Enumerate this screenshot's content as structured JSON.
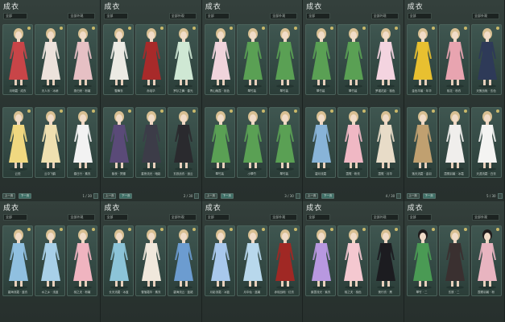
{
  "panels": [
    {
      "title": "成衣",
      "filter": "全部",
      "sort": "全部外观",
      "cards": [
        {
          "name": "月明霜 · 成衣",
          "c": "#c84548",
          "h": "#d8bf92"
        },
        {
          "name": "天人乐 · 冰绡",
          "c": "#ece2dc",
          "h": "#d8bf92"
        },
        {
          "name": "燕归来 · 粉裳",
          "c": "#e6c0c4",
          "h": "#d8bf92"
        },
        {
          "name": "云鬓",
          "c": "#f0d880",
          "h": "#d8bf92"
        },
        {
          "name": "云中飞鹤",
          "c": "#efe0b0",
          "h": "#d8bf92"
        },
        {
          "name": "春日行 · 素衣",
          "c": "#f2f2f2",
          "h": "#d8bf92"
        }
      ],
      "pager": {
        "prev": "上一页",
        "next": "下一页",
        "info": "1 / 30"
      }
    },
    {
      "title": "成衣",
      "filter": "全部",
      "sort": "全部外观",
      "cards": [
        {
          "name": "雪舞衣",
          "c": "#ecebe4",
          "h": "#d8bf92"
        },
        {
          "name": "赤焰华",
          "c": "#a82a2a",
          "h": "#d8bf92"
        },
        {
          "name": "罗衫之舞 · 春光",
          "c": "#cfe8d4",
          "h": "#d8bf92"
        },
        {
          "name": "紫夜 · 冥蝶",
          "c": "#5a4a78",
          "h": "#d8bf92"
        },
        {
          "name": "星夜流光 · 暗影",
          "c": "#3c3c48",
          "h": "#d8bf92"
        },
        {
          "name": "玄铁战衣 · 追云",
          "c": "#2a2a2e",
          "h": "#d8bf92"
        }
      ],
      "pager": {
        "prev": "上一页",
        "next": "下一页",
        "info": "2 / 30"
      }
    },
    {
      "title": "成衣",
      "filter": "全部",
      "sort": "全部外观",
      "cards": [
        {
          "name": "青山晚霞 · 桃色",
          "c": "#f0d4dc",
          "h": "#d8bf92"
        },
        {
          "name": "翠竹装",
          "c": "#5aa054",
          "h": "#d8bf92"
        },
        {
          "name": "翠竹装",
          "c": "#5aa054",
          "h": "#d8bf92"
        },
        {
          "name": "翠竹装",
          "c": "#5aa054",
          "h": "#d8bf92"
        },
        {
          "name": "小翠竹",
          "c": "#5aa054",
          "h": "#d8bf92"
        },
        {
          "name": "翠竹装",
          "c": "#5aa054",
          "h": "#d8bf92"
        }
      ],
      "pager": {
        "prev": "上一页",
        "next": "下一页",
        "info": "3 / 30"
      }
    },
    {
      "title": "成衣",
      "filter": "全部",
      "sort": "全部外观",
      "cards": [
        {
          "name": "翠竹装",
          "c": "#5aa054",
          "h": "#d8bf92"
        },
        {
          "name": "翠竹装",
          "c": "#5aa054",
          "h": "#d8bf92"
        },
        {
          "name": "罗裙花影 · 桃色",
          "c": "#f4d4e0",
          "h": "#d8bf92"
        },
        {
          "name": "碧月流霜",
          "c": "#88b4d8",
          "h": "#d8bf92"
        },
        {
          "name": "霞霓 · 粉衣",
          "c": "#f0b8c4",
          "h": "#d8bf92"
        },
        {
          "name": "霞霓 · 月华",
          "c": "#e8dcc8",
          "h": "#d8bf92"
        }
      ],
      "pager": {
        "prev": "上一页",
        "next": "下一页",
        "info": "4 / 30"
      }
    },
    {
      "title": "成衣",
      "filter": "全部",
      "sort": "全部外观",
      "cards": [
        {
          "name": "金色华裳 · 年华",
          "c": "#e8c030",
          "h": "#d8bf92"
        },
        {
          "name": "桃花 · 粉衣",
          "c": "#e8a4b0",
          "h": "#d8bf92"
        },
        {
          "name": "天策战袍 · 玄色",
          "c": "#2e3a58",
          "h": "#d8bf92"
        },
        {
          "name": "落天流霜 · 金羽",
          "c": "#c0a070",
          "h": "#d8bf92"
        },
        {
          "name": "霞霓羽裳 · 冰霜",
          "c": "#f0eeec",
          "h": "#d8bf92"
        },
        {
          "name": "天涯流霜 · 白衣",
          "c": "#f4f4f2",
          "h": "#d8bf92"
        }
      ],
      "pager": {
        "prev": "上一页",
        "next": "下一页",
        "info": "5 / 30"
      }
    },
    {
      "title": "成衣",
      "filter": "全部",
      "sort": "全部外观",
      "cards": [
        {
          "name": "碧海流霜 · 蓝衣",
          "c": "#90c0e0",
          "h": "#d8bf92"
        },
        {
          "name": "水之乡 · 浅蓝",
          "c": "#a8d0e8",
          "h": "#d8bf92"
        },
        {
          "name": "桃之夭 · 粉裳",
          "c": "#f0b4c0",
          "h": "#d8bf92"
        }
      ]
    },
    {
      "title": "成衣",
      "filter": "全部",
      "sort": "全部外观",
      "cards": [
        {
          "name": "长天流霜 · 冰蓝",
          "c": "#8cc4d8",
          "h": "#d8bf92"
        },
        {
          "name": "雪落霜华 · 素衣",
          "c": "#f0e8dc",
          "h": "#d8bf92"
        },
        {
          "name": "碧海流云 · 蓝裙",
          "c": "#6c9cd0",
          "h": "#d8bf92"
        }
      ]
    },
    {
      "title": "成衣",
      "filter": "全部",
      "sort": "全部外观",
      "cards": [
        {
          "name": "月影流霜 · 冰蓝",
          "c": "#a8c8ec",
          "h": "#d8bf92"
        },
        {
          "name": "月中仙 · 蓝裳",
          "c": "#b8d8ec",
          "h": "#d8bf92"
        },
        {
          "name": "赤焰战袍 · 红衣",
          "c": "#a02824",
          "h": "#d8bf92"
        }
      ]
    },
    {
      "title": "成衣",
      "filter": "全部",
      "sort": "全部外观",
      "cards": [
        {
          "name": "紫霞流光 · 紫衣",
          "c": "#b898e0",
          "h": "#d8bf92"
        },
        {
          "name": "桃之夭 · 桃色",
          "c": "#f4c8d0",
          "h": "#d8bf92"
        },
        {
          "name": "夜行衣 · 黑",
          "c": "#1c1c20",
          "h": "#d8bf92"
        }
      ]
    },
    {
      "title": "成衣",
      "filter": "全部",
      "sort": "全部外观",
      "cards": [
        {
          "name": "翠竹 · 二",
          "c": "#4a9a54",
          "h": "#201c1c"
        },
        {
          "name": "玄铁 · 二",
          "c": "#3a3030",
          "h": "#d8bf92"
        },
        {
          "name": "霞霓羽裳 · 粉",
          "c": "#e8b4c0",
          "h": "#201c1c"
        }
      ]
    }
  ]
}
